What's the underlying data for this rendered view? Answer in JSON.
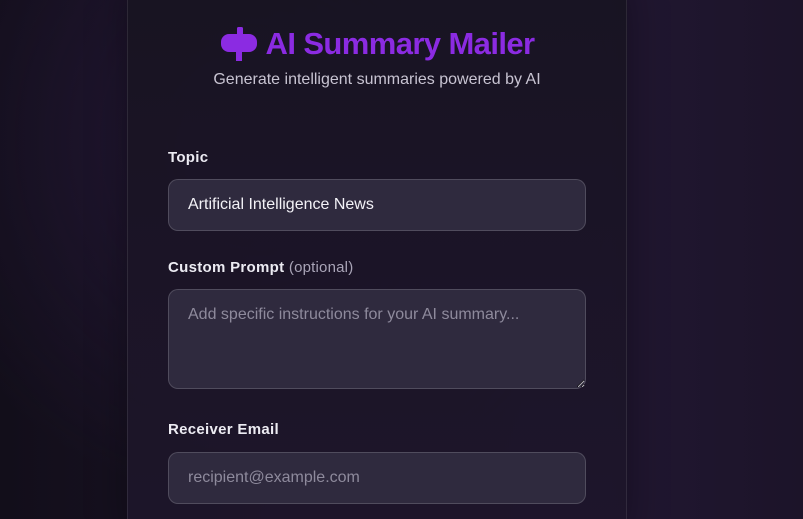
{
  "header": {
    "icon": "mailbox-icon",
    "title": "AI Summary Mailer",
    "subtitle": "Generate intelligent summaries powered by AI"
  },
  "form": {
    "topic": {
      "label": "Topic",
      "value": "Artificial Intelligence News"
    },
    "custom_prompt": {
      "label": "Custom Prompt",
      "optional_hint": "(optional)",
      "placeholder": "Add specific instructions for your AI summary..."
    },
    "receiver_email": {
      "label": "Receiver Email",
      "placeholder": "recipient@example.com"
    }
  },
  "colors": {
    "accent": "#8b2be2",
    "input_background": "#2f2a3e",
    "page_background": "#1a1325"
  }
}
